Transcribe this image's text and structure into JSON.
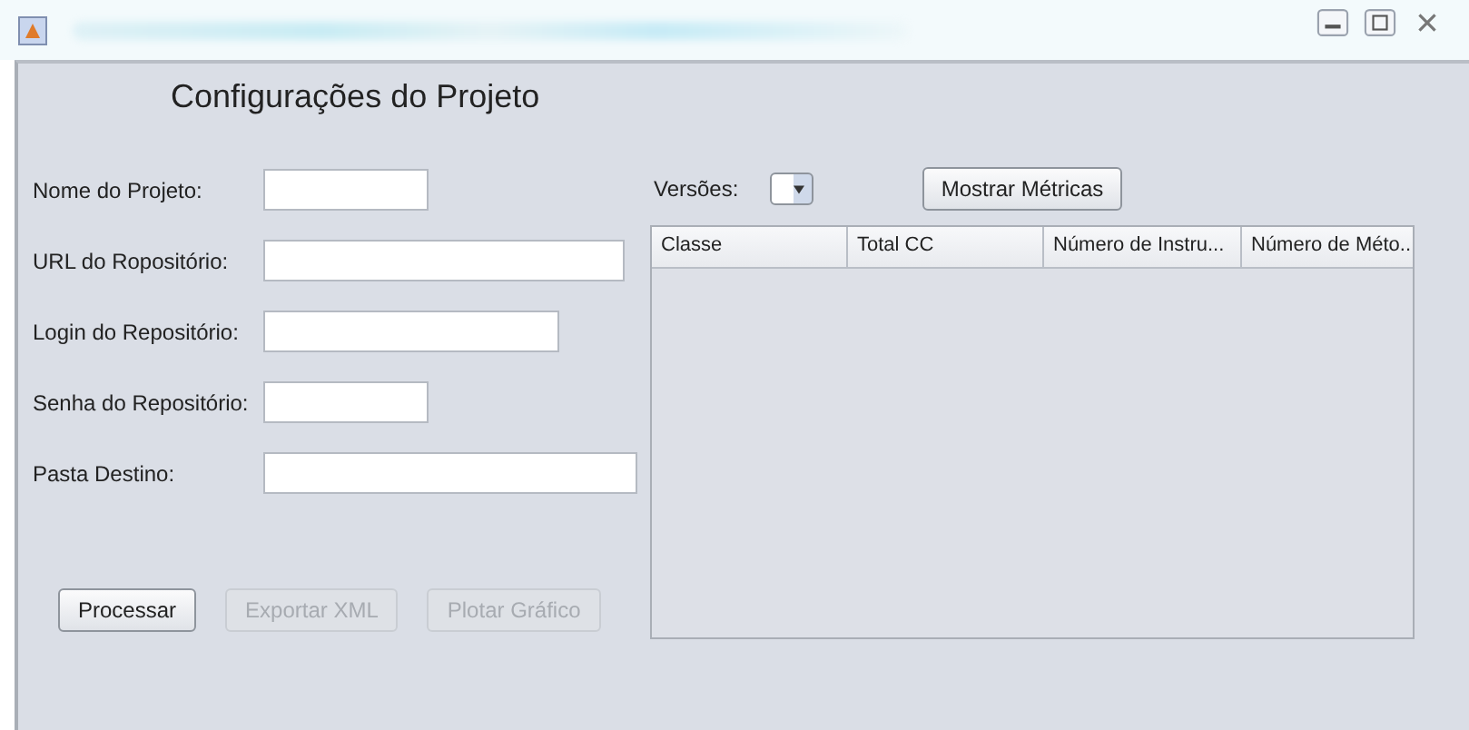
{
  "heading": "Configurações do Projeto",
  "fields": [
    {
      "label": "Nome do Projeto:"
    },
    {
      "label": "URL do Ropositório:"
    },
    {
      "label": "Login do Repositório:"
    },
    {
      "label": "Senha do Repositório:"
    },
    {
      "label": "Pasta Destino:"
    }
  ],
  "buttons": [
    {
      "label": "Processar",
      "disabled": false
    },
    {
      "label": "Exportar XML",
      "disabled": true
    },
    {
      "label": "Plotar Gráfico",
      "disabled": true
    }
  ],
  "versions": {
    "label": "Versões:"
  },
  "show_button": {
    "label": "Mostrar Métricas"
  },
  "table": {
    "columns": [
      "Classe",
      "Total CC",
      "Número de Instru...",
      "Número de Méto..."
    ]
  }
}
